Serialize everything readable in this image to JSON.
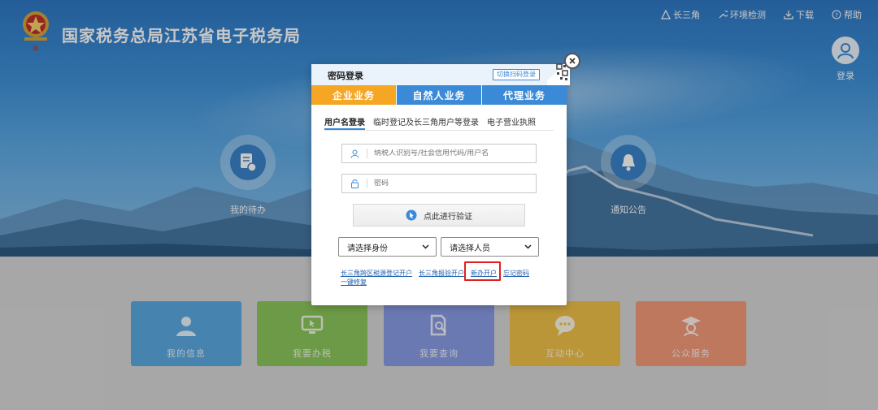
{
  "header": {
    "site_title": "国家税务总局江苏省电子税务局",
    "nav": [
      {
        "label": "长三角",
        "icon": "triangle-icon"
      },
      {
        "label": "环境检测",
        "icon": "wrench-icon"
      },
      {
        "label": "下载",
        "icon": "download-icon"
      },
      {
        "label": "帮助",
        "icon": "help-icon"
      }
    ],
    "login_label": "登录"
  },
  "hero": {
    "left_label": "我的待办",
    "right_label": "通知公告"
  },
  "tiles": [
    {
      "label": "我的信息",
      "color": "#5aa8df",
      "icon": "user-icon"
    },
    {
      "label": "我要办税",
      "color": "#8cc65a",
      "icon": "monitor-icon"
    },
    {
      "label": "我要查询",
      "color": "#8a9ce6",
      "icon": "search-doc-icon"
    },
    {
      "label": "互动中心",
      "color": "#f0c04a",
      "icon": "chat-icon"
    },
    {
      "label": "公众服务",
      "color": "#f39a78",
      "icon": "graduate-icon"
    }
  ],
  "modal": {
    "title": "密码登录",
    "switch_label": "切换扫码登录",
    "tabs": [
      {
        "label": "企业业务",
        "color": "#f5a623"
      },
      {
        "label": "自然人业务",
        "color": "#3a8ad8"
      },
      {
        "label": "代理业务",
        "color": "#3a8ad8"
      }
    ],
    "subtabs": [
      "用户名登录",
      "临时登记及长三角用户等登录",
      "电子营业执照"
    ],
    "username_placeholder": "纳税人识别号/社会信用代码/用户名",
    "password_placeholder": "密码",
    "verify_label": "点此进行验证",
    "identity_select": "请选择身份",
    "person_select": "请选择人员",
    "links": {
      "l1": "长三角跨区税源登记开户",
      "l2": "长三角报验开户",
      "l3": "新办开户",
      "l4": "忘记密码",
      "l5": "一键修复"
    }
  },
  "colors": {
    "accent": "#3a8ad8",
    "active_tab": "#f5a623",
    "highlight": "#e02020"
  }
}
